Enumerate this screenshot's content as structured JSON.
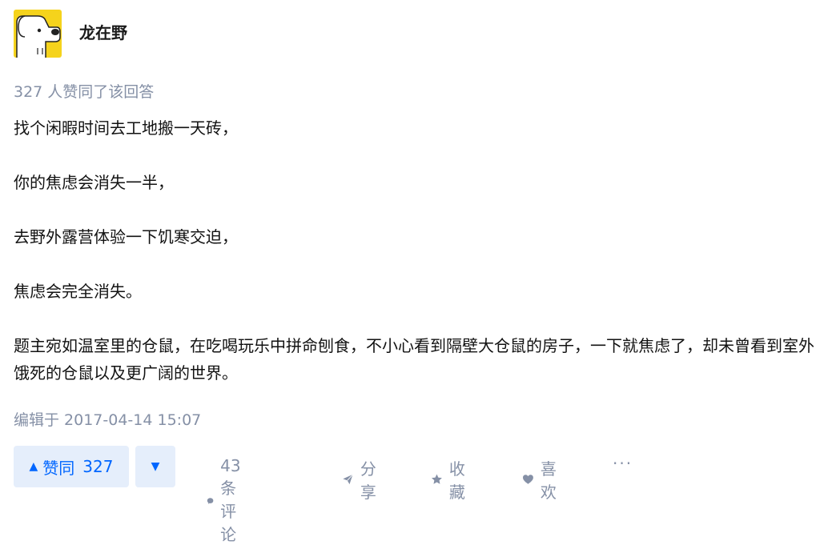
{
  "author": {
    "name": "龙在野"
  },
  "voters_text": "327 人赞同了该回答",
  "content": {
    "paragraphs": [
      "找个闲暇时间去工地搬一天砖，",
      "你的焦虑会消失一半，",
      "去野外露营体验一下饥寒交迫，",
      "焦虑会完全消失。"
    ],
    "last_paragraph": "题主宛如温室里的仓鼠，在吃喝玩乐中拼命刨食，不小心看到隔壁大仓鼠的房子，一下就焦虑了，却未曾看到室外饿死的仓鼠以及更广阔的世界。"
  },
  "edited_text": "编辑于 2017-04-14 15:07",
  "actions": {
    "upvote_label": "赞同",
    "upvote_count": "327",
    "comments_label": "43 条评论",
    "share_label": "分享",
    "collect_label": "收藏",
    "like_label": "喜欢",
    "more_label": "···"
  },
  "colors": {
    "accent": "#0066ff",
    "accent_bg": "#e5eefb",
    "muted": "#8590a6",
    "avatar_bg": "#f5d31c"
  }
}
